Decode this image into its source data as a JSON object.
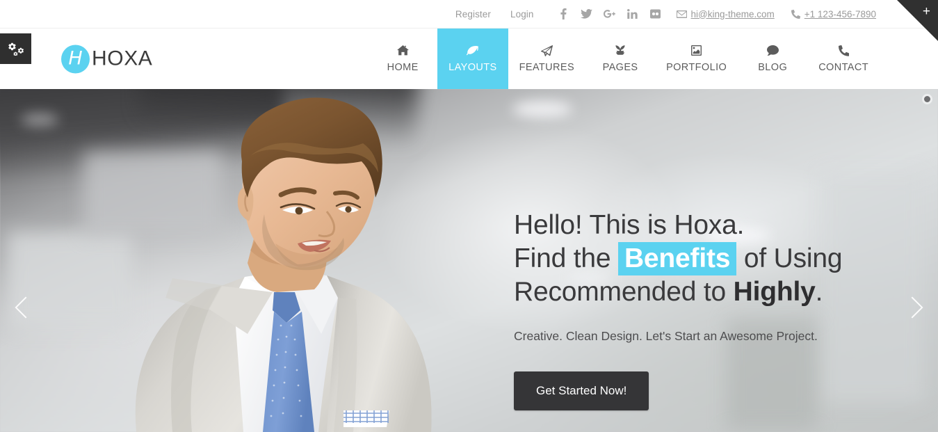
{
  "topbar": {
    "links": [
      {
        "label": "Register",
        "name": "register-link"
      },
      {
        "label": "Login",
        "name": "login-link"
      }
    ],
    "social": [
      {
        "name": "facebook-icon",
        "label": "Facebook"
      },
      {
        "name": "twitter-icon",
        "label": "Twitter"
      },
      {
        "name": "google-plus-icon",
        "label": "Google Plus"
      },
      {
        "name": "linkedin-icon",
        "label": "LinkedIn"
      },
      {
        "name": "flickr-icon",
        "label": "Flickr"
      }
    ],
    "email": "hi@king-theme.com",
    "phone": "+1 123-456-7890"
  },
  "corner": {
    "plus": "+"
  },
  "settings_tab": {
    "icon": "cogs-icon"
  },
  "brand": {
    "mark_letter": "H",
    "name": "HOXA"
  },
  "nav": {
    "items": [
      {
        "label": "HOME",
        "icon": "home-icon",
        "active": false
      },
      {
        "label": "LAYOUTS",
        "icon": "leaf-icon",
        "active": true
      },
      {
        "label": "FEATURES",
        "icon": "paper-plane-icon",
        "active": false
      },
      {
        "label": "PAGES",
        "icon": "seedling-icon",
        "active": false
      },
      {
        "label": "PORTFOLIO",
        "icon": "image-icon",
        "active": false
      },
      {
        "label": "BLOG",
        "icon": "comment-icon",
        "active": false
      },
      {
        "label": "CONTACT",
        "icon": "phone-icon",
        "active": false
      }
    ]
  },
  "hero": {
    "headline_line1": "Hello! This is Hoxa.",
    "headline_line2_pre": "Find the ",
    "headline_line2_mark": "Benefits",
    "headline_line2_post": " of Using",
    "headline_line3_pre": "Recommended to ",
    "headline_line3_bold": "Highly",
    "headline_line3_post": ".",
    "subhead": "Creative. Clean Design. Let's Start an Awesome Project.",
    "cta_label": "Get Started Now!",
    "prev_label": "Previous slide",
    "next_label": "Next slide",
    "dots": [
      {
        "active": true
      }
    ]
  },
  "colors": {
    "accent": "#5bd2f0",
    "dark": "#353537",
    "muted_text": "#9a9a9a",
    "nav_text": "#5c5c5c",
    "headline": "#3a3a3c"
  }
}
